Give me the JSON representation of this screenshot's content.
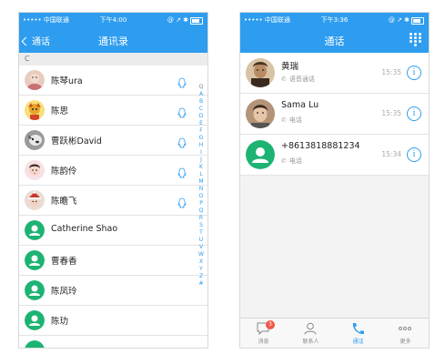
{
  "left": {
    "status": {
      "carrier": "••••• 中国联通 ",
      "time": "下午4:00",
      "right": "@ ↗ ✱"
    },
    "nav": {
      "back_label": "通话",
      "title": "通讯录"
    },
    "section": "C",
    "contacts": [
      {
        "name": "陈琴ura",
        "qq": true,
        "avatar_color": "#d7b3a0"
      },
      {
        "name": "陈思",
        "qq": true,
        "avatar_color": "#e6b033"
      },
      {
        "name": "曹跃彬David",
        "qq": true,
        "avatar_color": "#6d6d6d"
      },
      {
        "name": "陈韵伶",
        "qq": true,
        "avatar_color": "#f0cfd6"
      },
      {
        "name": "陈瞻飞",
        "qq": true,
        "avatar_color": "#b34a38"
      },
      {
        "name": "Catherine Shao",
        "qq": false,
        "avatar_color": "#1db373"
      },
      {
        "name": "曹春香",
        "qq": false,
        "avatar_color": "#1db373"
      },
      {
        "name": "陈凤玲",
        "qq": false,
        "avatar_color": "#1db373"
      },
      {
        "name": "陈玏",
        "qq": false,
        "avatar_color": "#1db373"
      }
    ],
    "index": [
      "Q",
      "A",
      "B",
      "C",
      "D",
      "E",
      "F",
      "G",
      "H",
      "I",
      "J",
      "K",
      "L",
      "M",
      "N",
      "O",
      "P",
      "Q",
      "R",
      "S",
      "T",
      "U",
      "V",
      "W",
      "X",
      "Y",
      "Z",
      "#"
    ]
  },
  "right": {
    "status": {
      "carrier": "••••• 中国联通 ",
      "time": "下午3:36",
      "right": "@ ↗ ✱"
    },
    "nav": {
      "title": "通话"
    },
    "calls": [
      {
        "name": "黄瑞",
        "type": "语音通话",
        "time": "15:35",
        "avatar_color": "#7a5a44"
      },
      {
        "name": "Sama Lu",
        "type": "电话",
        "time": "15:35",
        "avatar_color": "#8a6b52"
      },
      {
        "name": "+8613818881234",
        "type": "电话",
        "time": "15:34",
        "avatar_color": "#1db373"
      }
    ],
    "tabs": [
      {
        "label": "消息",
        "badge": "3"
      },
      {
        "label": "联系人"
      },
      {
        "label": "通话"
      },
      {
        "label": "更多"
      }
    ]
  },
  "colors": {
    "accent": "#2e9df0",
    "green": "#1db373",
    "badge": "#f05a4b"
  }
}
